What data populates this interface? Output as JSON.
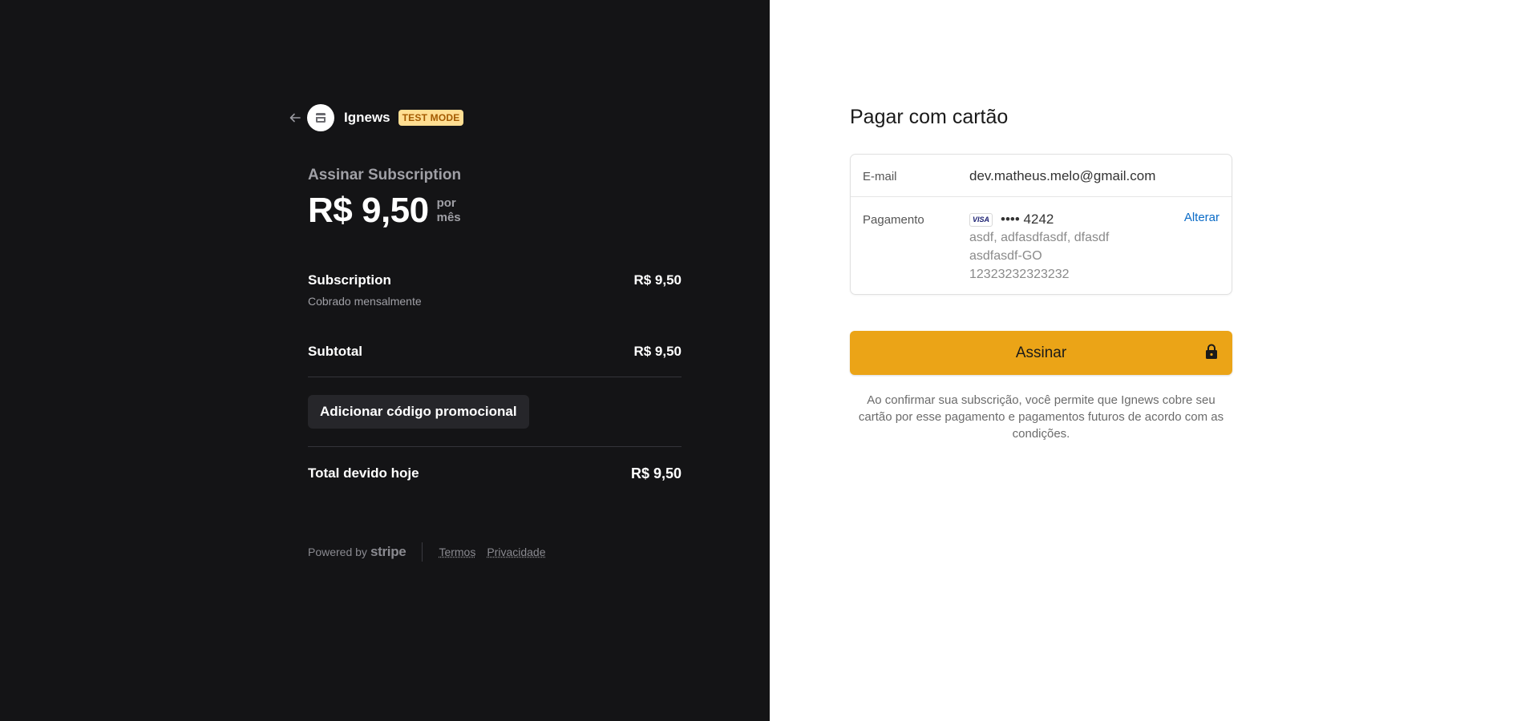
{
  "merchant": {
    "name": "Ignews",
    "badge": "TEST MODE"
  },
  "summary": {
    "title": "Assinar Subscription",
    "price": "R$ 9,50",
    "period_line1": "por",
    "period_line2": "mês",
    "item_label": "Subscription",
    "item_value": "R$ 9,50",
    "item_sub": "Cobrado mensalmente",
    "subtotal_label": "Subtotal",
    "subtotal_value": "R$ 9,50",
    "promo_label": "Adicionar código promocional",
    "total_label": "Total devido hoje",
    "total_value": "R$ 9,50"
  },
  "footer": {
    "powered_by": "Powered by",
    "stripe": "stripe",
    "terms": "Termos",
    "privacy": "Privacidade"
  },
  "payment": {
    "title": "Pagar com cartão",
    "email_label": "E-mail",
    "email_value": "dev.matheus.melo@gmail.com",
    "payment_label": "Pagamento",
    "card_brand": "VISA",
    "card_number": "•••• 4242",
    "change_label": "Alterar",
    "address_lines": [
      "asdf, adfasdfasdf, dfasdf",
      "asdfasdf-GO",
      "12323232323232"
    ],
    "subscribe_label": "Assinar",
    "consent_text": "Ao confirmar sua subscrição, você permite que Ignews cobre seu cartão por esse pagamento e pagamentos futuros de acordo com as condições."
  },
  "colors": {
    "left_bg": "#141416",
    "accent_button": "#eba417",
    "test_badge_bg": "#ffde92",
    "link": "#0a6bc7"
  },
  "icons": [
    "arrow-left-icon",
    "store-icon",
    "lock-icon"
  ]
}
